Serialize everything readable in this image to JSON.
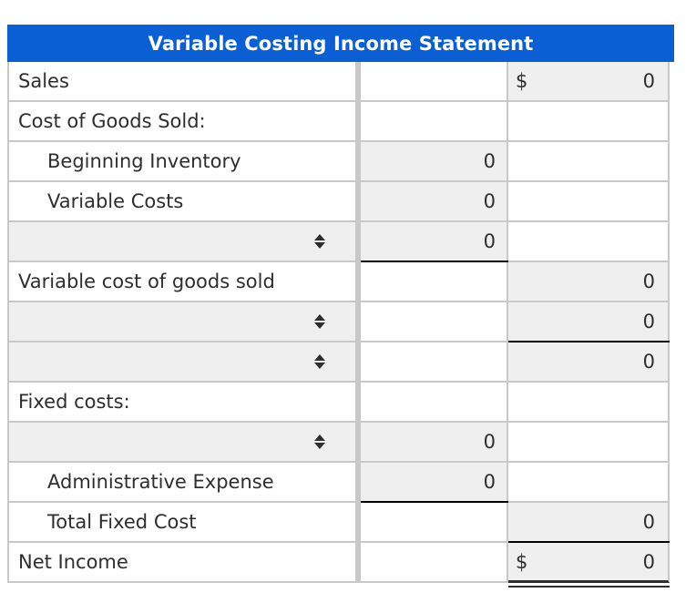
{
  "title": "Variable Costing Income Statement",
  "rows": [
    {
      "label": "Sales",
      "mid": "",
      "right": "0",
      "right_prefix": "$"
    },
    {
      "label": "Cost of Goods Sold:",
      "mid": "",
      "right": ""
    },
    {
      "label": "Beginning Inventory",
      "mid": "0",
      "right": ""
    },
    {
      "label": "Variable Costs",
      "mid": "0",
      "right": ""
    },
    {
      "label": "",
      "select": true,
      "mid": "0",
      "right": ""
    },
    {
      "label": "Variable cost of goods sold",
      "mid": "",
      "right": "0"
    },
    {
      "label": "",
      "select": true,
      "mid": "",
      "right": "0"
    },
    {
      "label": "",
      "select": true,
      "mid": "",
      "right": "0"
    },
    {
      "label": "Fixed costs:",
      "mid": "",
      "right": ""
    },
    {
      "label": "",
      "select": true,
      "mid": "0",
      "right": ""
    },
    {
      "label": "Administrative Expense",
      "mid": "0",
      "right": ""
    },
    {
      "label": "Total Fixed Cost",
      "mid": "",
      "right": "0"
    },
    {
      "label": "Net Income",
      "mid": "",
      "right": "0",
      "right_prefix": "$"
    }
  ]
}
